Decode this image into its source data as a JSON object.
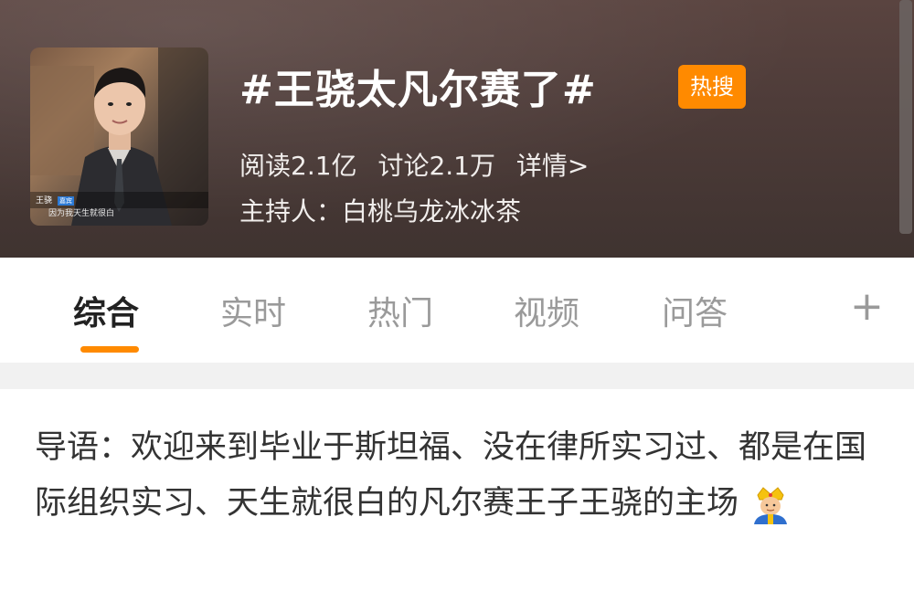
{
  "topic": {
    "title": "#王骁太凡尔赛了#",
    "badge": "热搜",
    "read": "阅读2.1亿",
    "discuss": "讨论2.1万",
    "detail": "详情>",
    "host": "主持人：白桃乌龙冰冰茶",
    "thumbnail": {
      "name_caption": "王骁",
      "tag": "嘉宾",
      "subtitle": "因为我天生就很白"
    }
  },
  "tabs": [
    "综合",
    "实时",
    "热门",
    "视频",
    "问答"
  ],
  "tabs_active_index": 0,
  "plus_label": "+",
  "intro": {
    "text": "导语：欢迎来到毕业于斯坦福、没在律所实习过、都是在国际组织实习、天生就很白的凡尔赛王子王骁的主场",
    "emoji": "prince-emoji"
  },
  "colors": {
    "accent": "#ff8a00",
    "header_bg": "#4e3c39",
    "active_tab": "#222222",
    "inactive_tab": "#9a9a9a"
  }
}
